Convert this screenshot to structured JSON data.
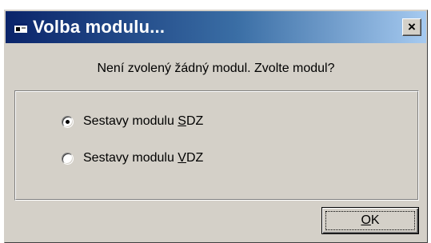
{
  "window": {
    "title": "Volba modulu...",
    "close_label": "×",
    "title_icon": "app-window-icon",
    "colors": {
      "title_start": "#0a246a",
      "title_end": "#a6caf0",
      "face": "#d4d0c8"
    }
  },
  "message": "Není zvolený žádný modul. Zvolte modul?",
  "options": [
    {
      "label_before": "Sestavy modulu ",
      "mnemonic": "S",
      "label_after": "DZ",
      "selected": true
    },
    {
      "label_before": "Sestavy modulu ",
      "mnemonic": "V",
      "label_after": "DZ",
      "selected": false
    }
  ],
  "ok_button": {
    "mnemonic": "O",
    "label_rest": "K"
  }
}
